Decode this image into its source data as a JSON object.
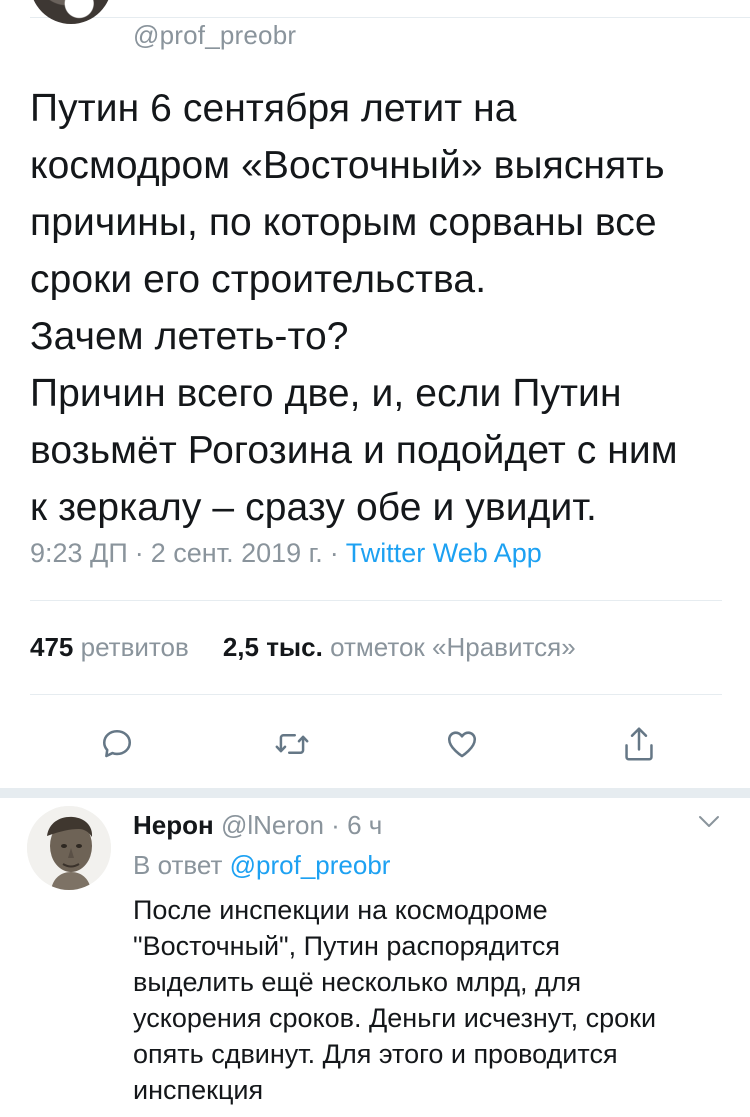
{
  "tweet": {
    "handle": "@prof_preobr",
    "text": "Путин 6 сентября летит на\nкосмодром «Восточный» выяснять\nпричины, по которым сорваны все\nсроки его строительства.\nЗачем лететь-то?\nПричин всего две, и, если Путин\nвозьмёт Рогозина и подойдет с ним\nк зеркалу – сразу обе и увидит.",
    "time": "9:23 ДП",
    "separator": "·",
    "date": "2 сент. 2019 г.",
    "source": "Twitter Web App",
    "retweets_count": "475",
    "retweets_label": "ретвитов",
    "likes_count": "2,5 тыс.",
    "likes_label": "отметок «Нравится»"
  },
  "actions": {
    "reply_icon": "speech-bubble-icon",
    "retweet_icon": "retweet-icon",
    "like_icon": "heart-icon",
    "share_icon": "share-icon"
  },
  "reply": {
    "name": "Нерон",
    "handle": "@lNeron",
    "separator": "·",
    "age": "6 ч",
    "reply_to_label": "В ответ",
    "reply_to_handle": "@prof_preobr",
    "text": "После инспекции на космодроме\n\"Восточный\", Путин распорядится\nвыделить ещё несколько млрд, для\nускорения сроков. Деньги исчезнут, сроки\nопять сдвинут. Для этого и проводится\nинспекция"
  },
  "colors": {
    "link": "#1da1f2",
    "secondary_text": "#8a949c",
    "primary_text": "#14171a",
    "divider": "#e6ecf0"
  }
}
